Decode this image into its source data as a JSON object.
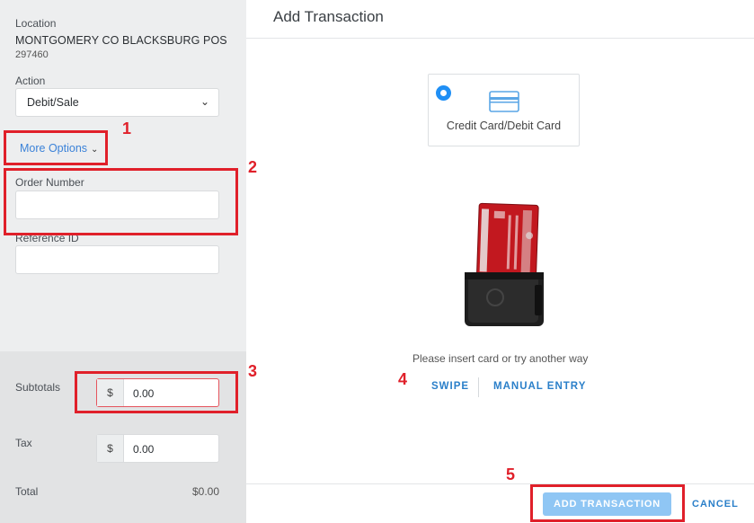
{
  "left_panel": {
    "location_label": "Location",
    "location_name": "MONTGOMERY CO BLACKSBURG POS",
    "location_id": "297460",
    "action_label": "Action",
    "action_value": "Debit/Sale",
    "more_options": "More Options",
    "order_number_label": "Order Number",
    "order_number_value": "",
    "reference_id_label": "Reference ID",
    "reference_id_value": "",
    "subtotals_label": "Subtotals",
    "subtotals_currency": "$",
    "subtotals_value": "0.00",
    "tax_label": "Tax",
    "tax_currency": "$",
    "tax_value": "0.00",
    "total_label": "Total",
    "total_value": "$0.00"
  },
  "main": {
    "title": "Add Transaction",
    "payment_option_label": "Credit Card/Debit Card",
    "prompt": "Please insert card or try another way",
    "swipe_label": "SWIPE",
    "manual_entry_label": "MANUAL ENTRY",
    "add_transaction_label": "ADD TRANSACTION",
    "cancel_label": "CANCEL"
  },
  "annotations": [
    "1",
    "2",
    "3",
    "4",
    "5"
  ],
  "colors": {
    "accent": "#2a7fc9",
    "link": "#3b82d8",
    "radio": "#1f8ff5",
    "button_disabled": "#8fc6f4",
    "annotation": "#e0202a",
    "panel_bg": "#edeeef"
  }
}
